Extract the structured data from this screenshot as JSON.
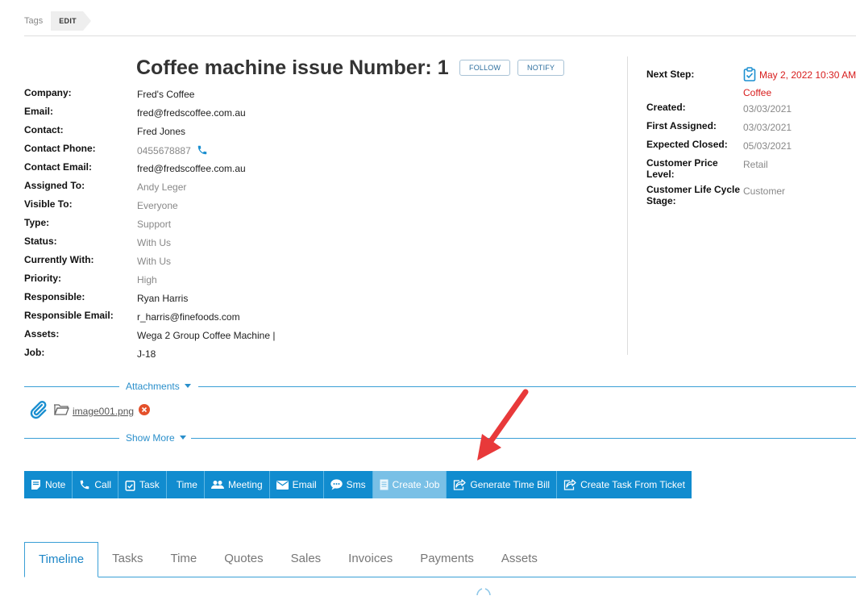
{
  "tags": {
    "label": "Tags",
    "edit": "EDIT"
  },
  "header": {
    "title": "Coffee machine issue Number: 1",
    "follow": "FOLLOW",
    "notify": "NOTIFY"
  },
  "fields": [
    {
      "label": "Company:",
      "value": "Fred's Coffee"
    },
    {
      "label": "Email:",
      "value": "fred@fredscoffee.com.au"
    },
    {
      "label": "Contact:",
      "value": "Fred Jones"
    },
    {
      "label": "Contact Phone:",
      "value": "0455678887"
    },
    {
      "label": "Contact Email:",
      "value": "fred@fredscoffee.com.au"
    },
    {
      "label": "Assigned To:",
      "value": "Andy Leger"
    },
    {
      "label": "Visible To:",
      "value": "Everyone"
    },
    {
      "label": "Type:",
      "value": "Support"
    },
    {
      "label": "Status:",
      "value": "With Us"
    },
    {
      "label": "Currently With:",
      "value": "With Us"
    },
    {
      "label": "Priority:",
      "value": "High"
    },
    {
      "label": "Responsible:",
      "value": "Ryan Harris"
    },
    {
      "label": "Responsible Email:",
      "value": "r_harris@finefoods.com"
    },
    {
      "label": "Assets:",
      "value": "Wega 2 Group Coffee Machine |"
    },
    {
      "label": "Job:",
      "value": "J-18"
    }
  ],
  "side": {
    "next_step_label": "Next Step:",
    "next_step_date": "May 2, 2022 10:30 AM",
    "next_step_name": "Coffee",
    "next_step_color": "#d71c1c",
    "created_label": "Created:",
    "created": "03/03/2021",
    "first_assigned_label": "First Assigned:",
    "first_assigned": "03/03/2021",
    "expected_closed_label": "Expected Closed:",
    "expected_closed": "05/03/2021",
    "price_level_label_1": "Customer Price",
    "price_level_label_2": "Level:",
    "price_level": "Retail",
    "lifecycle_label_1": "Customer Life Cycle",
    "lifecycle_label_2": "Stage:",
    "lifecycle": "Customer"
  },
  "attachments": {
    "label": "Attachments",
    "file": "image001.png"
  },
  "show_more": "Show More",
  "actions": [
    {
      "label": "Note",
      "icon": "note-icon"
    },
    {
      "label": "Call",
      "icon": "phone-icon"
    },
    {
      "label": "Task",
      "icon": "clipboard-icon"
    },
    {
      "label": "Time",
      "icon": "none"
    },
    {
      "label": "Meeting",
      "icon": "people-icon"
    },
    {
      "label": "Email",
      "icon": "envelope-icon"
    },
    {
      "label": "Sms",
      "icon": "chat-icon"
    },
    {
      "label": "Create Job",
      "icon": "document-icon"
    },
    {
      "label": "Generate Time Bill",
      "icon": "share-icon"
    },
    {
      "label": "Create Task From Ticket",
      "icon": "share-icon"
    }
  ],
  "tabs": [
    "Timeline",
    "Tasks",
    "Time",
    "Quotes",
    "Sales",
    "Invoices",
    "Payments",
    "Assets"
  ],
  "colors": {
    "accent": "#118ccf",
    "arrow": "#e8393a",
    "danger": "#d71c1c"
  }
}
